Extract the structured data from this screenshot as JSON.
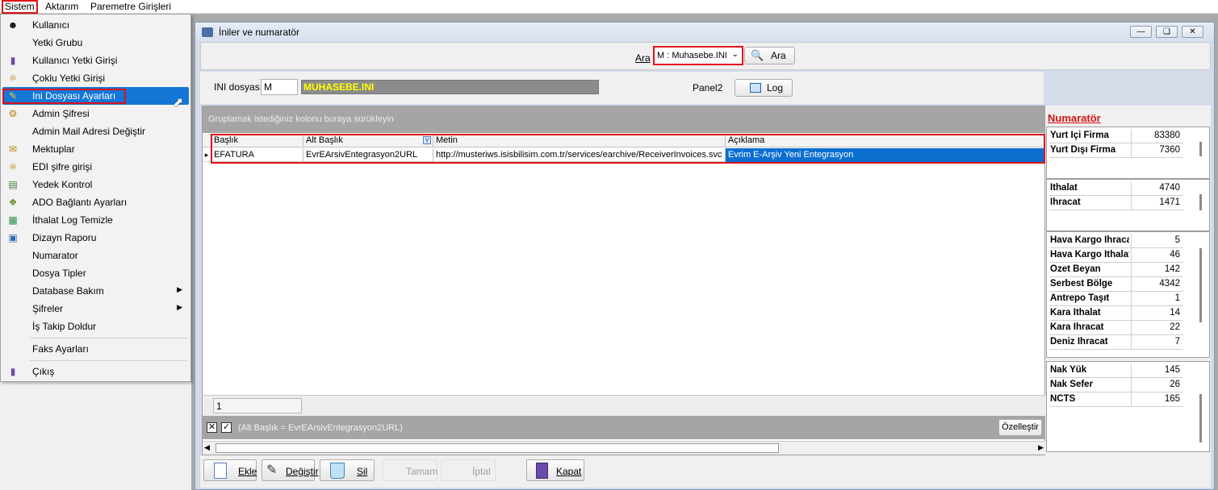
{
  "menubar": {
    "items": [
      "Sistem",
      "Aktarım",
      "Paremetre Girişleri"
    ]
  },
  "dropdown": {
    "items": [
      {
        "label": "Kullanıcı",
        "icon": "user-icon"
      },
      {
        "label": "Yetki Grubu",
        "icon": ""
      },
      {
        "label": "Kullanıcı Yetki Girişi",
        "icon": "door-icon"
      },
      {
        "label": "Çoklu Yetki Girişi",
        "icon": "key-icon"
      },
      {
        "label": "Ini Dosyası  Ayarları",
        "icon": "settings-file-icon"
      },
      {
        "label": "Admin Şifresi",
        "icon": "key-icon"
      },
      {
        "label": "Admin Mail Adresi Değiştir",
        "icon": ""
      },
      {
        "label": "Mektuplar",
        "icon": "letter-icon"
      },
      {
        "label": "EDI şifre girişi",
        "icon": "key-icon"
      },
      {
        "label": "Yedek Kontrol",
        "icon": "backup-icon"
      },
      {
        "label": "ADO Bağlantı Ayarları",
        "icon": "connection-icon"
      },
      {
        "label": "İthalat Log Temizle",
        "icon": "log-icon"
      },
      {
        "label": "Dizayn Raporu",
        "icon": "report-icon"
      },
      {
        "label": "Numarator",
        "icon": ""
      },
      {
        "label": "Dosya Tipler",
        "icon": ""
      },
      {
        "label": "Database Bakım",
        "icon": ""
      },
      {
        "label": "Şifreler",
        "icon": ""
      },
      {
        "label": "İş Takip Doldur",
        "icon": ""
      },
      {
        "label": "Faks Ayarları",
        "icon": ""
      },
      {
        "label": "Çıkış",
        "icon": "door-icon"
      }
    ]
  },
  "window": {
    "title": "İniler ve numaratör"
  },
  "search": {
    "label": "Ara",
    "selected": "M : Muhasebe.INI",
    "button": "Ara"
  },
  "ini": {
    "label": "INI dosyası",
    "value": "M",
    "name": "MUHASEBE.INI"
  },
  "panel2": {
    "label": "Panel2",
    "log_button": "Log"
  },
  "grid": {
    "group_hint": "Gruplamak istediğiniz kolonu buraya sürükleyin",
    "columns": [
      "Başlık",
      "Alt Başlık",
      "Metin",
      "Açıklama"
    ],
    "rows": [
      [
        "EFATURA",
        "EvrEArsivEntegrasyon2URL",
        "http://musteriws.isisbilisim.com.tr/services/earchive/ReceiverInvoices.svc",
        "Evrim E-Arşiv Yeni Entegrasyon"
      ]
    ],
    "footer_value": "1",
    "filter_text": "(Alt Başlık = EvrEArsivEntegrasyon2URL)",
    "customize_button": "Özelleştir"
  },
  "numerator": {
    "title": "Numaratör",
    "groups": [
      [
        {
          "label": "Yurt İçi Firma",
          "value": "83380"
        },
        {
          "label": "Yurt Dışı Firma",
          "value": "7360"
        }
      ],
      [
        {
          "label": "İthalat",
          "value": "4740"
        },
        {
          "label": "İhracat",
          "value": "1471"
        }
      ],
      [
        {
          "label": "Hava Kargo İhracat",
          "value": "5"
        },
        {
          "label": "Hava Kargo İthalat",
          "value": "46"
        },
        {
          "label": "Özet Beyan",
          "value": "142"
        },
        {
          "label": "Serbest Bölge",
          "value": "4342"
        },
        {
          "label": "Antrepo Taşıt",
          "value": "1"
        },
        {
          "label": "Kara İthalat",
          "value": "14"
        },
        {
          "label": "Kara İhracat",
          "value": "22"
        },
        {
          "label": "Deniz İhracat",
          "value": "7"
        }
      ],
      [
        {
          "label": "Nak Yük",
          "value": "145"
        },
        {
          "label": "Nak Sefer",
          "value": "26"
        },
        {
          "label": "NCTS",
          "value": "165"
        }
      ]
    ]
  },
  "toolbar": {
    "ekle": "Ekle",
    "degistir": "Değiştir",
    "sil": "Sil",
    "tamam": "Tamam",
    "iptal": "İptal",
    "kapat": "Kapat"
  },
  "colors": {
    "highlight": "#e0101a",
    "selection": "#0b6fd0",
    "numerator_title": "#d4140f",
    "ini_name": "#ffff00"
  }
}
